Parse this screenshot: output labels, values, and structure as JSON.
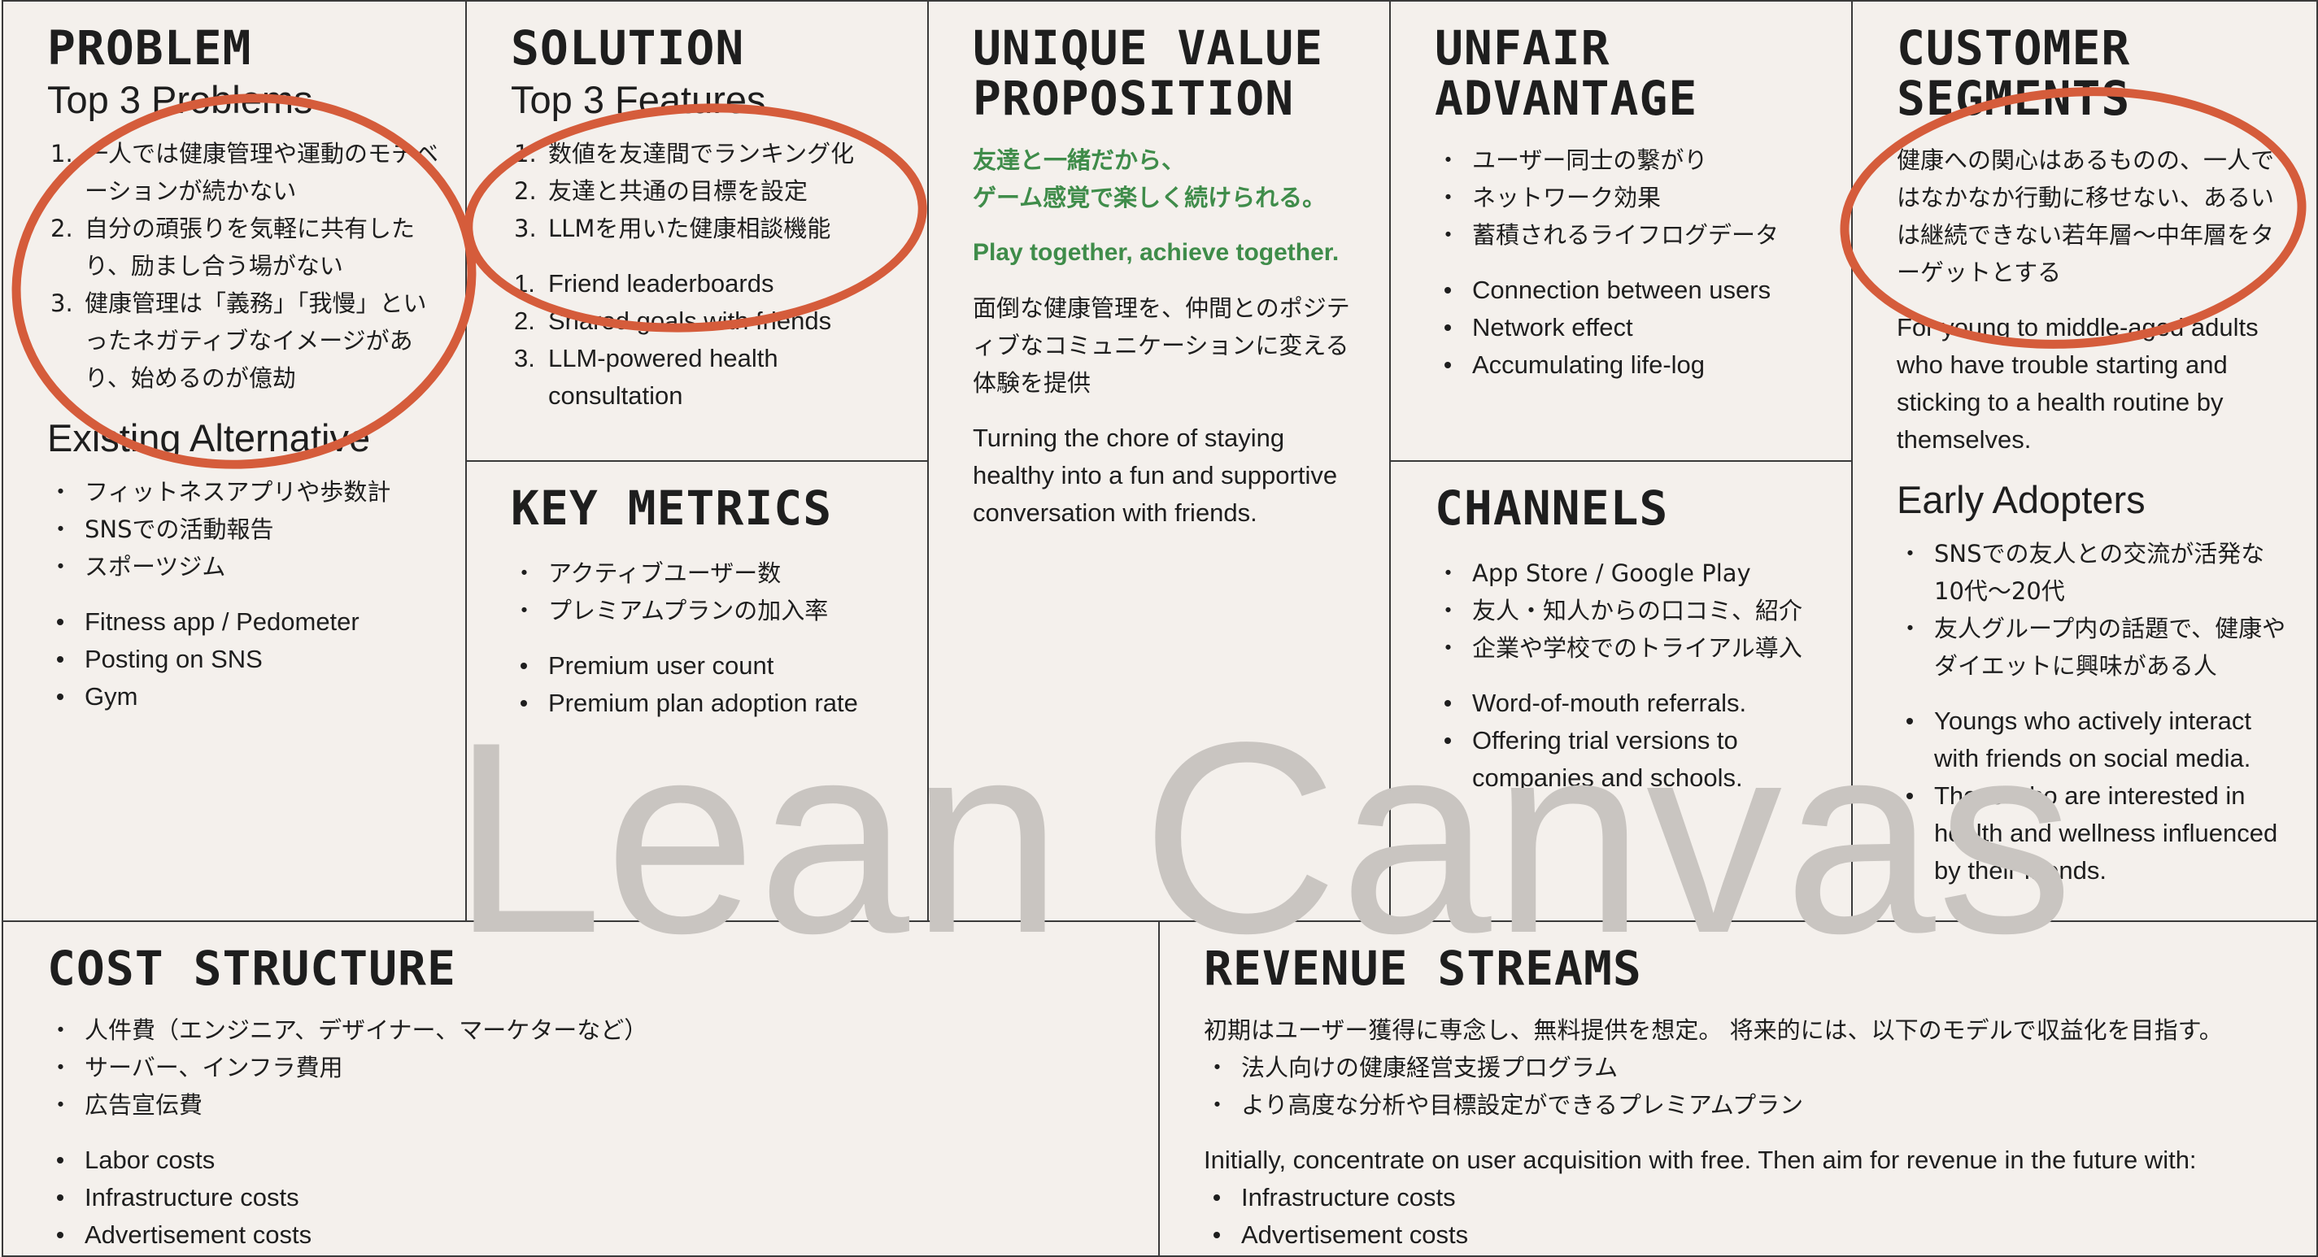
{
  "problem": {
    "title": "PROBLEM",
    "subhead": "Top 3 Problems",
    "items": [
      "一人では健康管理や運動のモチベーションが続かない",
      "自分の頑張りを気軽に共有したり、励まし合う場がない",
      "健康管理は「義務」「我慢」といったネガティブなイメージがあり、始めるのが億劫"
    ],
    "alt_subhead": "Existing Alternative",
    "alt_jp": [
      "フィットネスアプリや歩数計",
      "SNSでの活動報告",
      "スポーツジム"
    ],
    "alt_en": [
      "Fitness app / Pedometer",
      "Posting on SNS",
      "Gym"
    ]
  },
  "solution": {
    "title": "SOLUTION",
    "subhead": "Top 3 Features",
    "items_jp": [
      "数値を友達間でランキング化",
      "友達と共通の目標を設定",
      "LLMを用いた健康相談機能"
    ],
    "items_en": [
      "Friend leaderboards",
      "Shared goals with friends",
      "LLM-powered health consultation"
    ]
  },
  "key_metrics": {
    "title": "KEY METRICS",
    "items_jp": [
      "アクティブユーザー数",
      "プレミアムプランの加入率"
    ],
    "items_en": [
      "Premium user count",
      "Premium plan adoption rate"
    ]
  },
  "uvp": {
    "title": "UNIQUE VALUE\nPROPOSITION",
    "tagline_jp": "友達と一緒だから、\nゲーム感覚で楽しく続けられる。",
    "tagline_en": "Play together, achieve together.",
    "desc_jp": "面倒な健康管理を、仲間とのポジティブなコミュニケーションに変える体験を提供",
    "desc_en": "Turning the chore of staying healthy into a fun and supportive conversation with friends."
  },
  "unfair_advantage": {
    "title": "UNFAIR\nADVANTAGE",
    "items_jp": [
      "ユーザー同士の繋がり",
      "ネットワーク効果",
      "蓄積されるライフログデータ"
    ],
    "items_en": [
      "Connection between users",
      "Network effect",
      "Accumulating life-log"
    ]
  },
  "channels": {
    "title": "CHANNELS",
    "items_jp": [
      "App Store / Google Play",
      "友人・知人からの口コミ、紹介",
      "企業や学校でのトライアル導入"
    ],
    "items_en": [
      "Word-of-mouth referrals.",
      "Offering trial versions to companies and schools."
    ]
  },
  "customer_segments": {
    "title": "CUSTOMER\nSEGMENTS",
    "desc_jp": "健康への関心はあるものの、一人ではなかなか行動に移せない、あるいは継続できない若年層〜中年層をターゲットとする",
    "desc_en": "For young to middle-aged adults who have trouble starting and sticking to a health routine by themselves.",
    "early_subhead": "Early Adopters",
    "early_jp": [
      "SNSでの友人との交流が活発な10代〜20代",
      "友人グループ内の話題で、健康やダイエットに興味がある人"
    ],
    "early_en": [
      "Youngs who actively interact with friends on social media.",
      "Those who are interested in health and wellness influenced by their friends."
    ]
  },
  "cost_structure": {
    "title": "COST STRUCTURE",
    "items_jp": [
      "人件費（エンジニア、デザイナー、マーケターなど）",
      "サーバー、インフラ費用",
      "広告宣伝費"
    ],
    "items_en": [
      "Labor costs",
      "Infrastructure costs",
      "Advertisement costs"
    ]
  },
  "revenue_streams": {
    "title": "REVENUE STREAMS",
    "intro_jp": "初期はユーザー獲得に専念し、無料提供を想定。 将来的には、以下のモデルで収益化を目指す。",
    "items_jp": [
      "法人向けの健康経営支援プログラム",
      "より高度な分析や目標設定ができるプレミアムプラン"
    ],
    "intro_en": "Initially, concentrate on user acquisition with free. Then aim for revenue in the future with:",
    "items_en": [
      "Infrastructure costs",
      "Advertisement costs"
    ]
  },
  "watermark": "Lean Canvas",
  "colors": {
    "background": "#f4f0ec",
    "accent_green": "#3f8c4a",
    "annotation_red": "#d55c3b",
    "watermark": "#c9c5c1"
  }
}
